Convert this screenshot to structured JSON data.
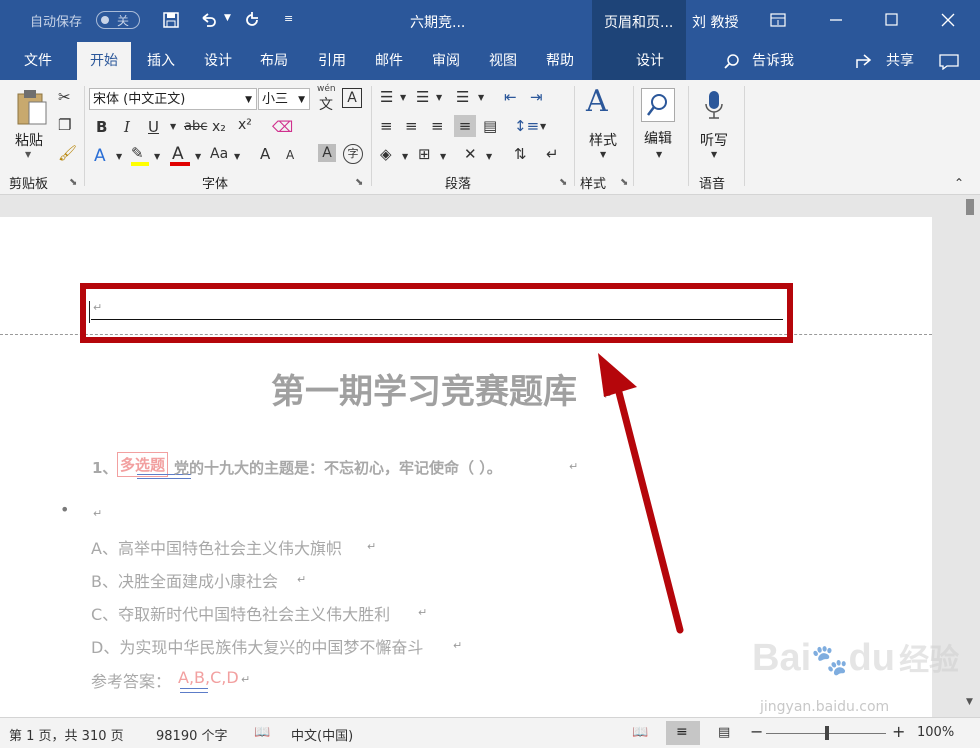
{
  "titlebar": {
    "autosave_label": "自动保存",
    "autosave_state": "关",
    "doc_title": "六期竞...",
    "context_tab": "页眉和页...",
    "user": "刘 教授"
  },
  "tabs": [
    "文件",
    "开始",
    "插入",
    "设计",
    "布局",
    "引用",
    "邮件",
    "审阅",
    "视图",
    "帮助",
    "设计"
  ],
  "tellme": "告诉我",
  "share": "共享",
  "ribbon": {
    "paste": "粘贴",
    "clipboard_group": "剪贴板",
    "font_name": "宋体 (中文正文)",
    "font_size": "小三",
    "font_group": "字体",
    "paragraph_group": "段落",
    "styles": "样式",
    "styles_group": "样式",
    "editing": "编辑",
    "dictate": "听写",
    "voice_group": "语音",
    "wen": "wén",
    "A_box": "A",
    "bold": "B",
    "italic": "I",
    "underline": "U",
    "strike": "abc",
    "sub": "x₂",
    "sup": "x²",
    "aa": "Aa",
    "grow": "A",
    "shrink": "A",
    "charshade": "A",
    "encircle": "字"
  },
  "document": {
    "header_mark": "↵",
    "title": "第一期学习竞赛题库",
    "question_label": "1、",
    "question_tag": "多选题",
    "question_text": "党的十九大的主题是：不忘初心，牢记使命（ ）。",
    "options": [
      "A、高举中国特色社会主义伟大旗帜",
      "B、决胜全面建成小康社会",
      "C、夺取新时代中国特色社会主义伟大胜利",
      "D、为实现中华民族伟大复兴的中国梦不懈奋斗"
    ],
    "answer_label": "参考答案：",
    "answer_value": "A,B,C,D",
    "para_mark": "↵",
    "bullet": "•"
  },
  "watermark": {
    "brand": "Bai",
    "brand2": "du",
    "cn": "经验",
    "url": "jingyan.baidu.com"
  },
  "status": {
    "page": "第 1 页，共 310 页",
    "words": "98190 个字",
    "lang": "中文(中国)",
    "zoom": "100%"
  },
  "colors": {
    "brand": "#2b579a",
    "highlight_box": "#b5060b"
  }
}
